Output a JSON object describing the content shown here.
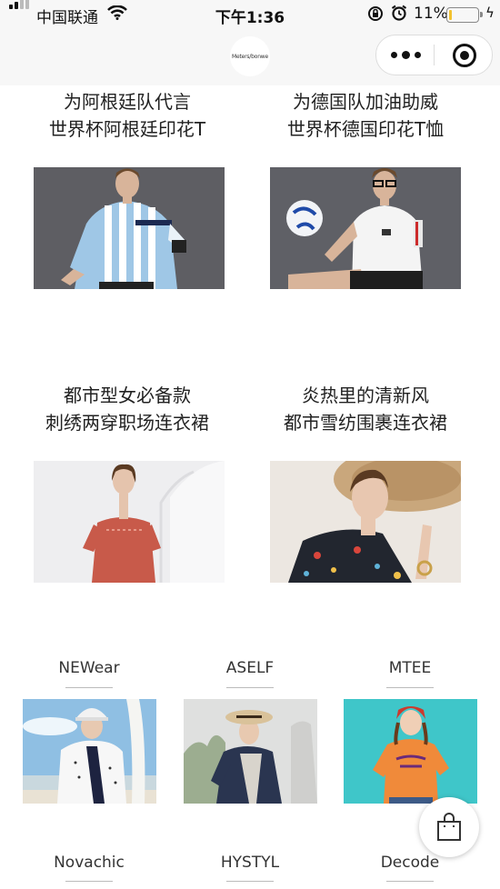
{
  "status_bar": {
    "carrier": "中国联通",
    "time": "下午1:36",
    "battery_percent": "11%",
    "battery_level": 0.11
  },
  "nav": {
    "logo_text": "Meters/bonwe"
  },
  "features": [
    {
      "line1": "为阿根廷队代言",
      "line2": "世界杯阿根廷印花T",
      "image": "man-argentina-jersey"
    },
    {
      "line1": "为德国队加油助威",
      "line2": "世界杯德国印花T恤",
      "image": "man-white-tee-football"
    },
    {
      "line1": "都市型女必备款",
      "line2": "刺绣两穿职场连衣裙",
      "image": "woman-red-dress"
    },
    {
      "line1": "炎热里的清新风",
      "line2": "都市雪纺围裹连衣裙",
      "image": "woman-floral-straw-hat"
    }
  ],
  "brands": [
    {
      "name": "NEWear",
      "image": "boy-bucket-hat-beach"
    },
    {
      "name": "ASELF",
      "image": "woman-denim-jacket"
    },
    {
      "name": "MTEE",
      "image": "girl-orange-tee"
    },
    {
      "name": "Novachic"
    },
    {
      "name": "HYSTYL"
    },
    {
      "name": "Decode"
    }
  ],
  "colors": {
    "background": "#ffffff",
    "bar": "#f7f7f7",
    "battery": "#f2c230"
  }
}
